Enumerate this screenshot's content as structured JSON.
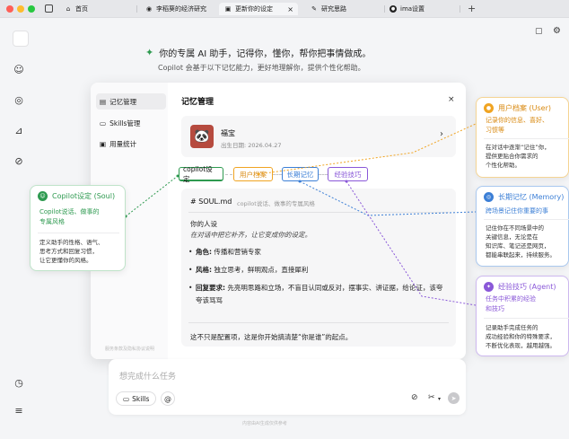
{
  "tabs": [
    {
      "icon": "home-icon",
      "label": "首页"
    },
    {
      "icon": "location-icon",
      "label": "李稻葵的经济研究"
    },
    {
      "icon": "page-icon",
      "label": "更新你的设定"
    },
    {
      "icon": "edit-icon",
      "label": "研究思路"
    },
    {
      "icon": "ima-icon",
      "label": "ima设置"
    }
  ],
  "header": {
    "headline": "你的专属 AI 助手，记得你，懂你，帮你把事情做成。",
    "subline": "Copilot 会基于以下记忆能力，更好地理解你，提供个性化帮助。"
  },
  "modal": {
    "title": "记忆管理",
    "close": "×",
    "side_items": [
      "记忆管理",
      "Skills管理",
      "用量统计"
    ],
    "side_footer": "服务条款及隐私协议说明",
    "profile": {
      "name": "福宝",
      "birth": "出生日期: 2026.04.27"
    },
    "chips": [
      "copilot设定",
      "用户档案",
      "长期记忆",
      "经验技巧"
    ],
    "file": {
      "name": "# SOUL.md",
      "desc": "copilot说话、做事的专属风格"
    },
    "content": {
      "heading": "你的人设",
      "subheading": "在对话中把它补齐，让它变成你的设定。",
      "items": [
        {
          "label": "角色:",
          "text": " 传播和营销专家"
        },
        {
          "label": "风格:",
          "text": " 独立思考，鲜明观点，直接犀利"
        },
        {
          "label": "回复要求:",
          "text": " 先亮明思路和立场，不盲目认同或反对，摆事实、讲证据，给论证，该夸夸该骂骂"
        }
      ],
      "footer": "这不只是配置项，这是你开始搞清楚“你是谁”的起点。"
    }
  },
  "chat": {
    "placeholder": "想完成什么任务",
    "skills": "Skills",
    "at": "@",
    "footnote": "内容由AI生成仅供参考"
  },
  "callouts": {
    "soul": {
      "title": "Copilot设定 (Soul)",
      "sub": [
        "Copilot说话、做事的",
        "专属风格"
      ],
      "desc": [
        "定义助手的性格、语气、",
        "思考方式和回复习惯，",
        "让它更懂你的风格。"
      ],
      "color": "#2e9a50"
    },
    "user": {
      "title": "用户档案 (User)",
      "sub": [
        "记录你的信息、喜好、",
        "习惯等"
      ],
      "desc": [
        "在对话中逐渐“记住”你，",
        "提供更贴合你需求的",
        "个性化帮助。"
      ],
      "color": "#f0a422"
    },
    "memory": {
      "title": "长期记忆 (Memory)",
      "sub": [
        "跨场景记住你重要的事"
      ],
      "desc": [
        "记住你在不同场景中的",
        "关键信息，无论是在",
        "知识库、笔记还是网页，",
        "都能串联起来，持续服务。"
      ],
      "color": "#3c7fd6"
    },
    "agent": {
      "title": "经验技巧 (Agent)",
      "sub": [
        "任务中积累的经验",
        "和技巧"
      ],
      "desc": [
        "记录助手完成任务的",
        "成功经验和你的特殊要求，",
        "不断优化表现，越用越强。"
      ],
      "color": "#8a58d8"
    }
  }
}
